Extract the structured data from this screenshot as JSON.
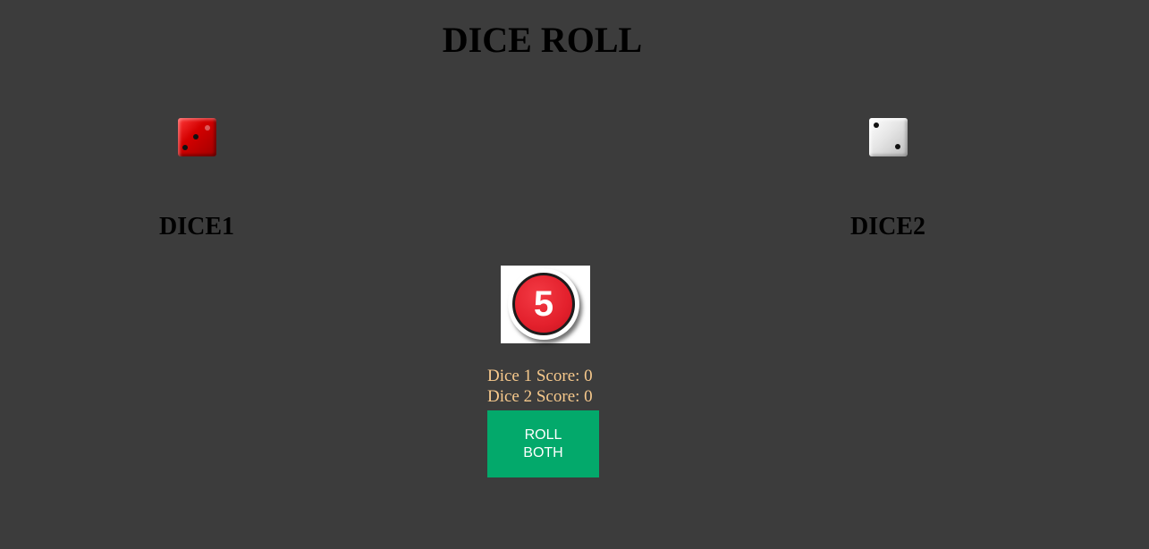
{
  "title": "DICE ROLL",
  "dice": [
    {
      "label": "DICE1",
      "color": "red",
      "face": 3
    },
    {
      "label": "DICE2",
      "color": "white",
      "face": 2
    }
  ],
  "badge": {
    "number": "5",
    "color": "#e3202c"
  },
  "scores": {
    "dice1": "Dice 1 Score: 0",
    "dice2": "Dice 2 Score: 0"
  },
  "roll_button": {
    "label": "ROLL BOTH",
    "color": "#03a96b"
  },
  "colors": {
    "background": "#3c3c3c",
    "score_text": "#f7c98c"
  }
}
